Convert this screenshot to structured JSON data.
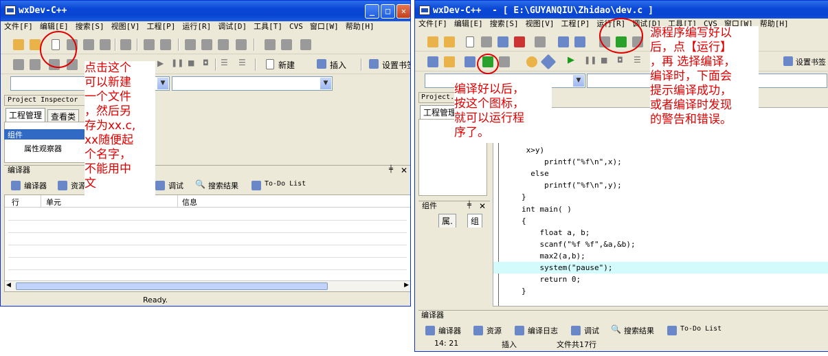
{
  "left_window": {
    "title": "wxDev-C++",
    "menu": [
      "文件[F]",
      "编辑[E]",
      "搜索[S]",
      "视图[V]",
      "工程[P]",
      "运行[R]",
      "调试[D]",
      "工具[T]",
      "CVS",
      "窗口[W]",
      "帮助[H]"
    ],
    "toolbar2": {
      "new_label": "新建",
      "insert_label": "插入",
      "bookmark_label": "设置书签"
    },
    "project_inspector": "Project Inspector",
    "tabs": [
      "工程管理",
      "查看类"
    ],
    "components": "组件",
    "properties": "属性观察器",
    "compiler_panel": "编译器",
    "bottom_tabs": {
      "compiler": "编译器",
      "resources": "资源",
      "debug": "调试",
      "search": "搜索结果",
      "todo": "To-Do List"
    },
    "columns": [
      "行",
      "单元",
      "信息"
    ],
    "status": "Ready."
  },
  "right_window": {
    "title": "wxDev-C++  - [ E:\\GUYANQIU\\Zhidao\\dev.c ]",
    "menu": [
      "文件[F]",
      "编辑[E]",
      "搜索[S]",
      "视图[V]",
      "工程[P]",
      "运行[R]",
      "调试[D]",
      "工具[T]",
      "CVS",
      "窗口[W]",
      "帮助[H]"
    ],
    "bookmark_label": "设置书签",
    "project_tab": "Project.",
    "proj_mgmt_tab": "工程管理",
    "components": "组件",
    "comp_tabs": [
      "属.",
      "组"
    ],
    "code_lines": [
      ",y)",
      " x,y;",
      "",
      " x>y)",
      "     printf(\"%f\\n\",x);",
      "  else",
      "     printf(\"%f\\n\",y);",
      "}",
      "int main( )",
      "{",
      "    float a, b;",
      "    scanf(\"%f %f\",&a,&b);",
      "    max2(a,b);",
      "    system(\"pause\");",
      "    return 0;",
      "}"
    ],
    "compiler_panel": "编译器",
    "bottom_tabs": {
      "compiler": "编译器",
      "resources": "资源",
      "log": "编译日志",
      "debug": "调试",
      "search": "搜索结果",
      "todo": "To-Do List"
    },
    "status": {
      "pos": "14: 21",
      "mode": "插入",
      "lines": "文件共17行"
    }
  },
  "annotations": {
    "new_file": "点击这个\n可以新建\n一个文件\n，然后另\n存为xx.c,\nxx随便起\n个名字，\n不能用中\n文",
    "run": "编译好以后，\n按这个图标，\n就可以运行程\n序了。",
    "compile": "源程序编写好以\n后，点【运行】\n，再 选择编译，\n编译时，下面会\n提示编译成功，\n或者编译时发现\n的警告和错误。"
  },
  "colors": {
    "annotation": "#e00000",
    "titlebar": "#0a46d6",
    "highlight": "#d3fbfb"
  }
}
